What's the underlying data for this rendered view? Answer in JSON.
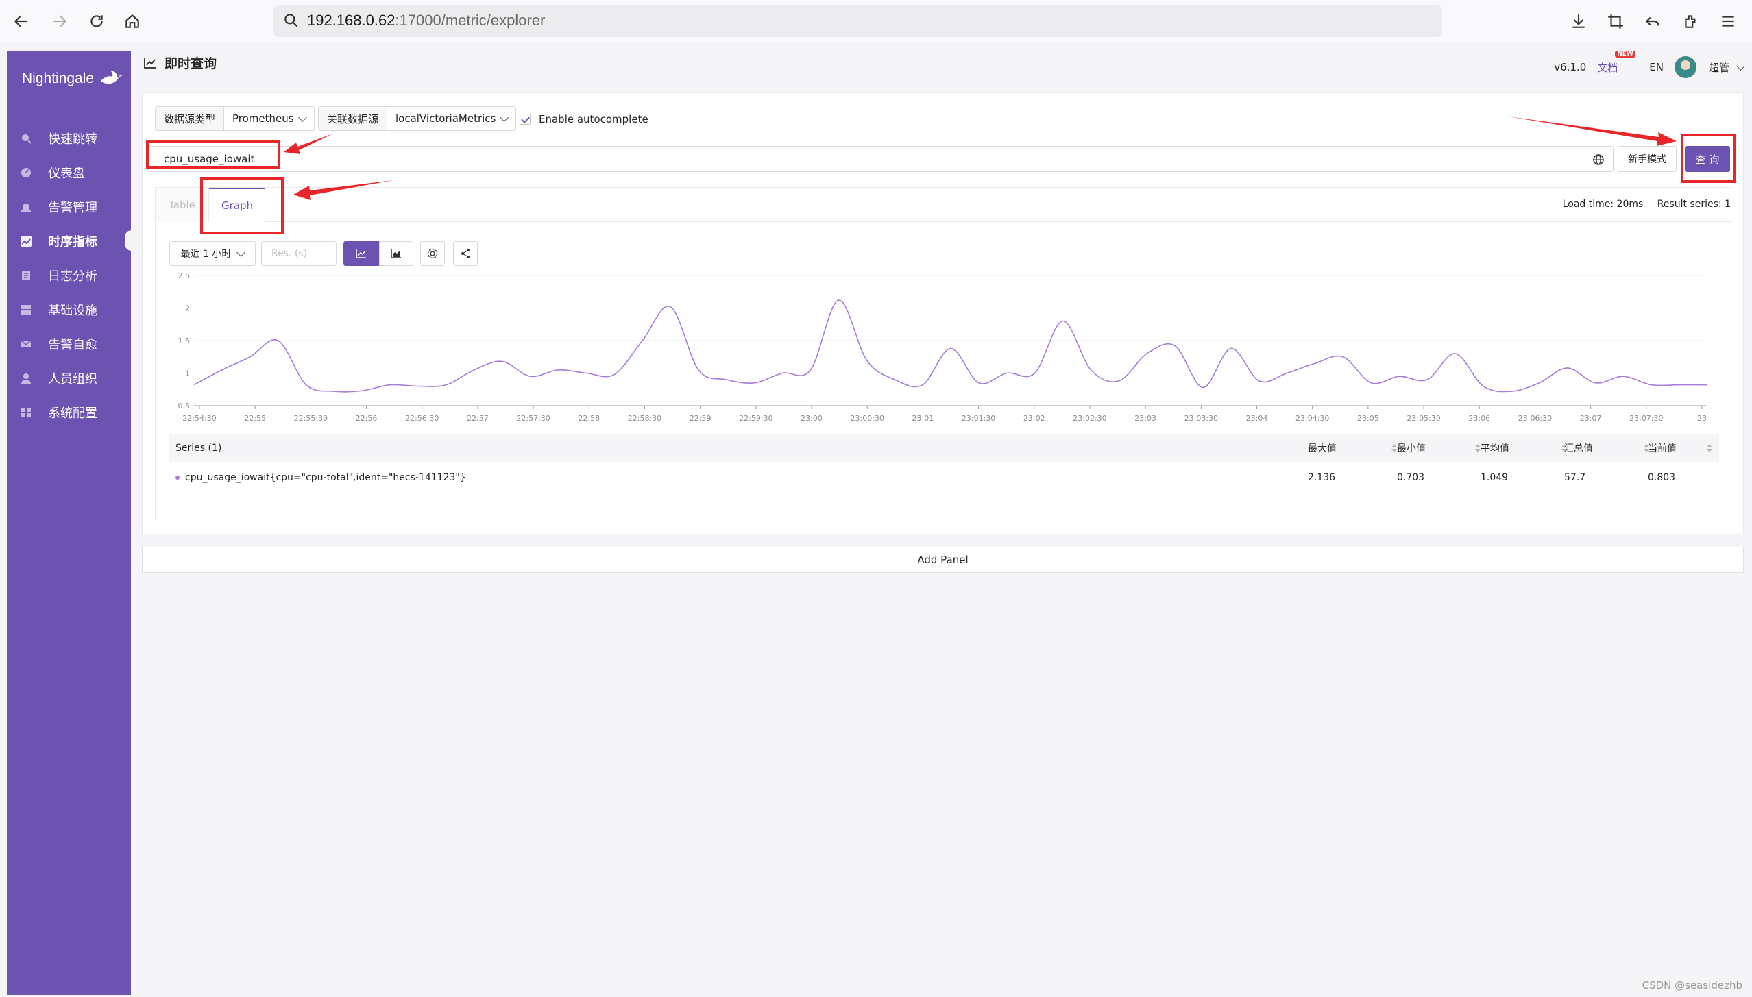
{
  "browser": {
    "url_host": "192.168.0.62",
    "url_rest": ":17000/metric/explorer"
  },
  "sidebar": {
    "logo": "Nightingale",
    "items": [
      {
        "label": "快速跳转",
        "icon": "search-icon"
      },
      {
        "label": "仪表盘",
        "icon": "dashboard-icon"
      },
      {
        "label": "告警管理",
        "icon": "alarm-icon"
      },
      {
        "label": "时序指标",
        "icon": "chart-icon"
      },
      {
        "label": "日志分析",
        "icon": "log-icon"
      },
      {
        "label": "基础设施",
        "icon": "server-icon"
      },
      {
        "label": "告警自愈",
        "icon": "mail-icon"
      },
      {
        "label": "人员组织",
        "icon": "user-icon"
      },
      {
        "label": "系统配置",
        "icon": "grid-icon"
      }
    ]
  },
  "header": {
    "title": "即时查询",
    "version": "v6.1.0",
    "docs": "文档",
    "docs_badge": "NEW",
    "lang": "EN",
    "user": "超管"
  },
  "query": {
    "ds_type_label": "数据源类型",
    "ds_type_value": "Prometheus",
    "ds_label": "关联数据源",
    "ds_value": "localVictoriaMetrics",
    "autocomplete_label": "Enable autocomplete",
    "autocomplete_checked": true,
    "promql": "cpu_usage_iowait",
    "novice_button": "新手模式",
    "query_button": "查 询"
  },
  "tabs": {
    "table": "Table",
    "graph": "Graph",
    "active": "Graph",
    "load_time": "Load time: 20ms",
    "result_series": "Result series: 1"
  },
  "controls": {
    "time_range": "最近 1 小时",
    "res_placeholder": "Res. (s)"
  },
  "chart_data": {
    "type": "line",
    "ylim": [
      0.5,
      2.5
    ],
    "yticks": [
      "2.5",
      "2",
      "1.5",
      "1",
      "0.5"
    ],
    "xticks": [
      "22:54:30",
      "22:55",
      "22:55:30",
      "22:56",
      "22:56:30",
      "22:57",
      "22:57:30",
      "22:58",
      "22:58:30",
      "22:59",
      "22:59:30",
      "23:00",
      "23:00:30",
      "23:01",
      "23:01:30",
      "23:02",
      "23:02:30",
      "23:03",
      "23:03:30",
      "23:04",
      "23:04:30",
      "23:05",
      "23:05:30",
      "23:06",
      "23:06:30",
      "23:07",
      "23:07:30",
      "23"
    ],
    "line_color": "#a77bd9",
    "series": [
      {
        "name": "cpu_usage_iowait{cpu=\"cpu-total\",ident=\"hecs-141123\"}",
        "values": [
          0.82,
          1.05,
          1.25,
          1.5,
          0.82,
          0.72,
          0.73,
          0.82,
          0.8,
          0.82,
          1.05,
          1.18,
          0.95,
          1.05,
          1.0,
          0.98,
          1.5,
          2.02,
          1.05,
          0.9,
          0.85,
          1.0,
          1.05,
          2.12,
          1.2,
          0.9,
          0.82,
          1.38,
          0.85,
          1.0,
          1.0,
          1.8,
          1.05,
          0.88,
          1.3,
          1.42,
          0.78,
          1.38,
          0.88,
          1.0,
          1.15,
          1.25,
          0.85,
          0.95,
          0.9,
          1.3,
          0.8,
          0.72,
          0.85,
          1.08,
          0.85,
          0.95,
          0.82,
          0.82,
          0.82
        ]
      }
    ]
  },
  "series_table": {
    "header": "Series (1)",
    "columns": [
      "最大值",
      "最小值",
      "平均值",
      "汇总值",
      "当前值"
    ],
    "rows": [
      {
        "name": "cpu_usage_iowait{cpu=\"cpu-total\",ident=\"hecs-141123\"}",
        "max": "2.136",
        "min": "0.703",
        "avg": "1.049",
        "sum": "57.7",
        "current": "0.803"
      }
    ]
  },
  "add_panel": "Add Panel",
  "watermark": "CSDN @seasidezhb"
}
